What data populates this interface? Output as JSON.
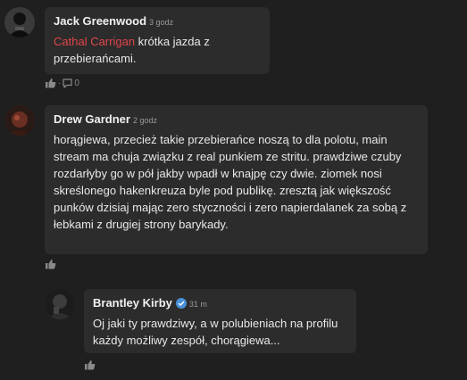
{
  "comments": [
    {
      "author": "Jack Greenwood",
      "time": "3 godz",
      "mention": "Cathal Carrigan",
      "text": " krótka jazda z przebierańcami.",
      "reply_count": "0"
    },
    {
      "author": "Drew Gardner",
      "time": "2 godz",
      "text": "horągiewa, przecież takie przebierańce noszą to dla polotu, main stream ma chuja związku z real punkiem ze stritu. prawdziwe czuby rozdarłyby go w pół jakby wpadł w knajpę czy dwie. ziomek nosi skreślonego hakenkreuza byle pod publikę. zresztą jak większość punków dzisiaj mając zero styczności i zero napierdalanek za sobą z łebkami z drugiej strony barykady."
    },
    {
      "author": "Brantley Kirby",
      "time": "31 m",
      "text": "Oj jaki ty prawdziwy, a w polubieniach na profilu każdy możliwy zespół, chorągiewa..."
    }
  ],
  "colors": {
    "background": "#1f1f1f",
    "bubble": "#2c2c2c",
    "mention": "#e0464a",
    "verified": "#4a90d9"
  },
  "icons": [
    "like-icon",
    "comment-icon",
    "verified-badge-icon"
  ]
}
